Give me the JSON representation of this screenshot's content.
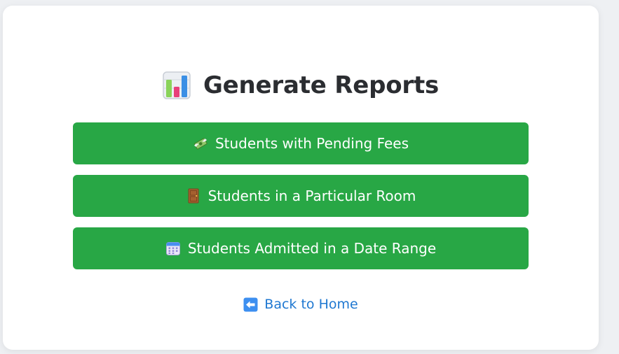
{
  "page": {
    "title": "Generate Reports",
    "title_icon": "bar-chart-icon"
  },
  "reports": [
    {
      "label": "Students with Pending Fees",
      "icon": "money-with-wings-icon"
    },
    {
      "label": "Students in a Particular Room",
      "icon": "door-icon"
    },
    {
      "label": "Students Admitted in a Date Range",
      "icon": "calendar-icon"
    }
  ],
  "back_link": {
    "label": "Back to Home",
    "icon": "left-arrow-icon"
  },
  "colors": {
    "button": "#28a745",
    "link": "#1f78d1",
    "title": "#2b2d31",
    "background": "#eef0f3"
  }
}
